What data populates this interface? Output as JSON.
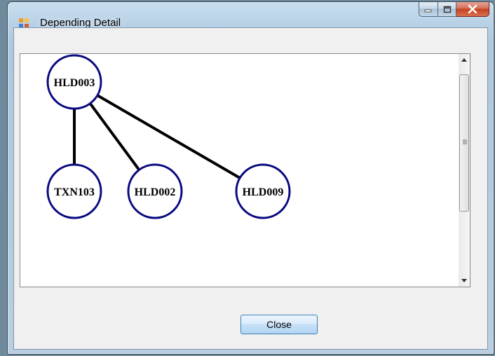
{
  "window": {
    "title": "Depending Detail"
  },
  "graph": {
    "nodes": [
      {
        "id": "HLD003"
      },
      {
        "id": "TXN103"
      },
      {
        "id": "HLD002"
      },
      {
        "id": "HLD009"
      }
    ],
    "edges": [
      {
        "from": "HLD003",
        "to": "TXN103"
      },
      {
        "from": "HLD003",
        "to": "HLD002"
      },
      {
        "from": "HLD003",
        "to": "HLD009"
      }
    ],
    "node_border_color": "#0a0a80",
    "edge_color": "#000000"
  },
  "footer": {
    "close_label": "Close"
  }
}
